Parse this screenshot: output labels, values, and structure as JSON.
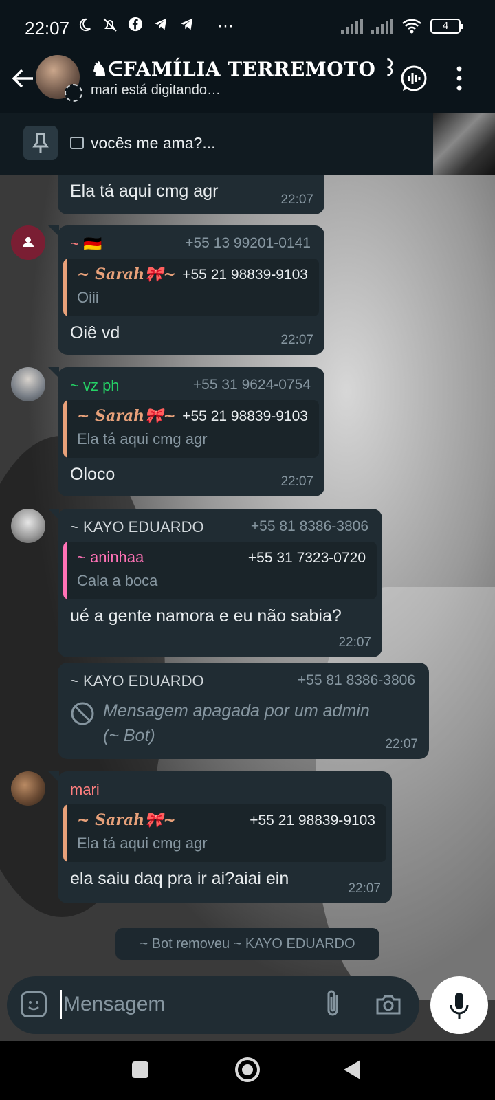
{
  "status": {
    "time": "22:07",
    "battery": "4",
    "icons": [
      "moon-icon",
      "mute-icon",
      "facebook-icon",
      "telegram-icon",
      "telegram-icon",
      "more-icon"
    ]
  },
  "header": {
    "group_name": "♞ᕮFAMÍLIA TERREMOTO ꒱",
    "typing": "mari está digitando…"
  },
  "pinned": {
    "text": "vocês me ama?..."
  },
  "messages": [
    {
      "text": "Ela tá aqui cmg agr",
      "time": "22:07"
    },
    {
      "sender": "~ 🇩🇪",
      "phone": "+55 13 99201-0141",
      "quote": {
        "name": "~ Sarah🎀~",
        "phone": "+55 21 98839-9103",
        "text": "Oiii"
      },
      "text": "Oiê vd",
      "time": "22:07"
    },
    {
      "sender": "~ vz ph",
      "phone": "+55 31 9624-0754",
      "quote": {
        "name": "~ Sarah🎀~",
        "phone": "+55 21 98839-9103",
        "text": "Ela tá aqui cmg agr"
      },
      "text": "Oloco",
      "time": "22:07"
    },
    {
      "sender": "~ KAYO EDUARDO",
      "phone": "+55 81 8386-3806",
      "quote": {
        "name": "~ aninhaa",
        "phone": "+55 31 7323-0720",
        "text": "Cala a boca"
      },
      "text": "ué a gente namora e eu não sabia?",
      "time": "22:07"
    },
    {
      "sender": "~ KAYO EDUARDO",
      "phone": "+55 81 8386-3806",
      "deleted_line1": "Mensagem apagada por um admin",
      "deleted_line2": "(~ Bot)",
      "time": "22:07"
    },
    {
      "sender": "mari",
      "quote": {
        "name": "~ Sarah🎀~",
        "phone": "+55 21 98839-9103",
        "text": "Ela tá aqui cmg agr"
      },
      "text": "ela saiu daq pra ir ai?aiai ein",
      "time": "22:07"
    }
  ],
  "system_message": "~ Bot removeu ~ KAYO EDUARDO",
  "input": {
    "placeholder": "Mensagem"
  },
  "colors": {
    "sarah_quote": "#e8a17a",
    "aninhaa_quote": "#ff72b6",
    "vzph_name": "#25d366",
    "mari_name": "#ff7f7f",
    "flag_sender": "#ff7f7f",
    "kayo_name": "#d1d7db"
  }
}
